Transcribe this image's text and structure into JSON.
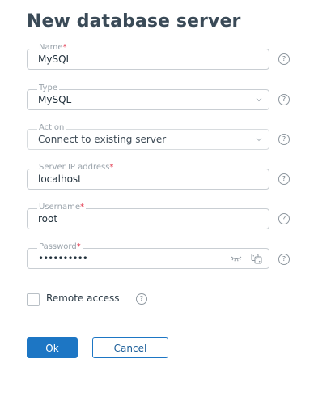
{
  "dialog": {
    "title": "New database server"
  },
  "fields": {
    "name": {
      "label": "Name",
      "required": "*",
      "value": "MySQL"
    },
    "type": {
      "label": "Type",
      "value": "MySQL"
    },
    "action": {
      "label": "Action",
      "value": "Connect to existing server"
    },
    "server_ip": {
      "label": "Server IP address",
      "required": "*",
      "value": "localhost"
    },
    "username": {
      "label": "Username",
      "required": "*",
      "value": "root"
    },
    "password": {
      "label": "Password",
      "required": "*",
      "value": "••••••••••"
    }
  },
  "remote_access": {
    "label": "Remote access",
    "checked": false
  },
  "help_glyph": "?",
  "buttons": {
    "ok": "Ok",
    "cancel": "Cancel"
  },
  "icons": {
    "help": "question-circle-icon",
    "dropdown": "chevron-down-icon",
    "show_password": "eye-closed-icon",
    "generate_password": "dice-icon"
  },
  "colors": {
    "primary": "#1d76c4",
    "required": "#e2354b",
    "border": "#c9ced3",
    "label": "#9aa3ab"
  }
}
